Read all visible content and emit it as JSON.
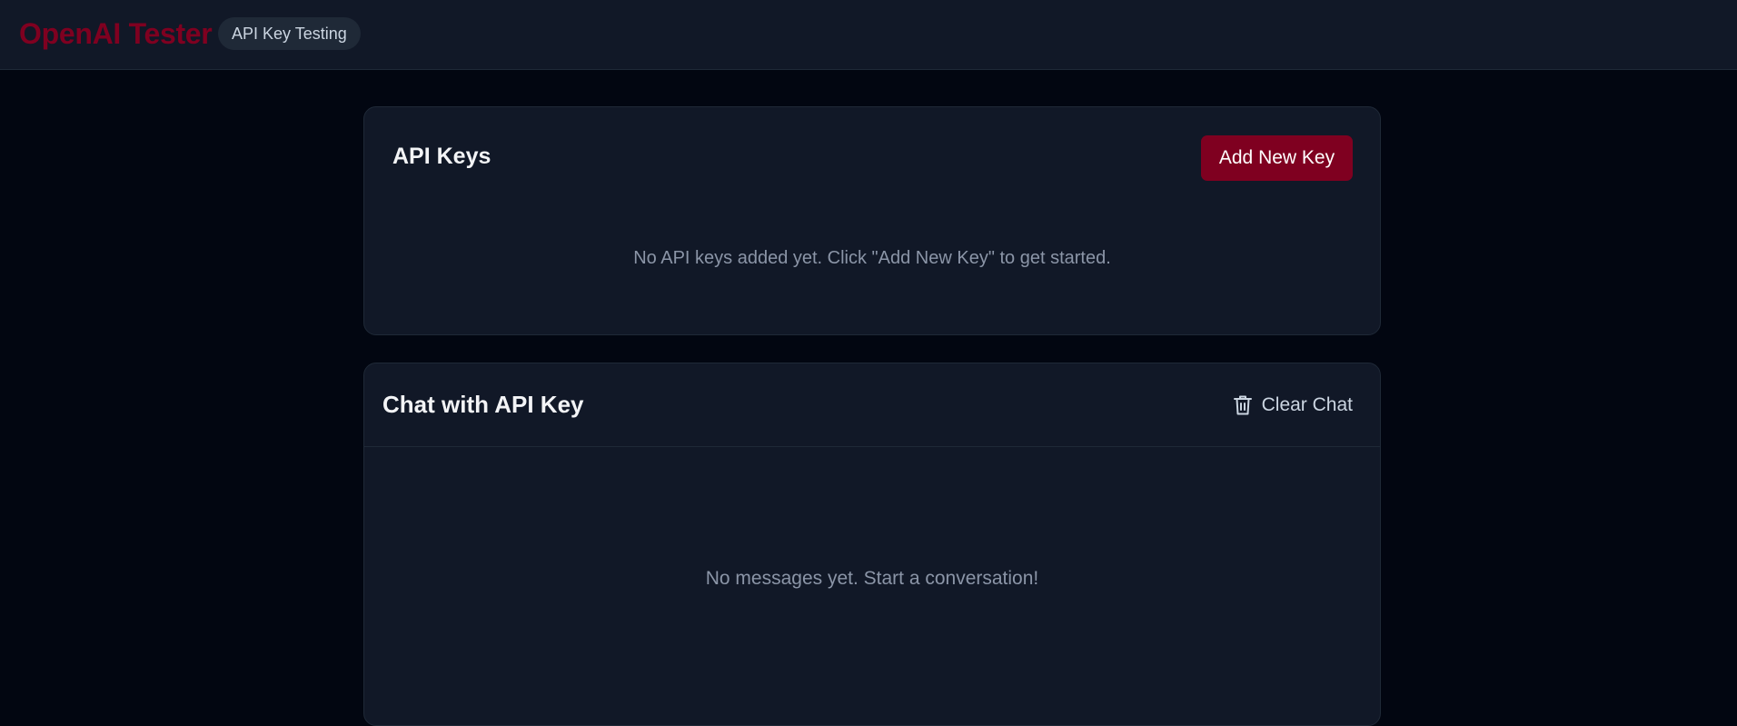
{
  "header": {
    "brand": "OpenAI Tester",
    "badge": "API Key Testing"
  },
  "keys_card": {
    "title": "API Keys",
    "add_button": "Add New Key",
    "empty_message": "No API keys added yet. Click \"Add New Key\" to get started."
  },
  "chat_card": {
    "title": "Chat with API Key",
    "clear_button": "Clear Chat",
    "clear_icon": "trash-icon",
    "empty_message": "No messages yet. Start a conversation!"
  },
  "colors": {
    "accent": "#7f0020",
    "page_background": "#020611",
    "card_background": "#111827",
    "muted_text": "#8b95a7"
  }
}
